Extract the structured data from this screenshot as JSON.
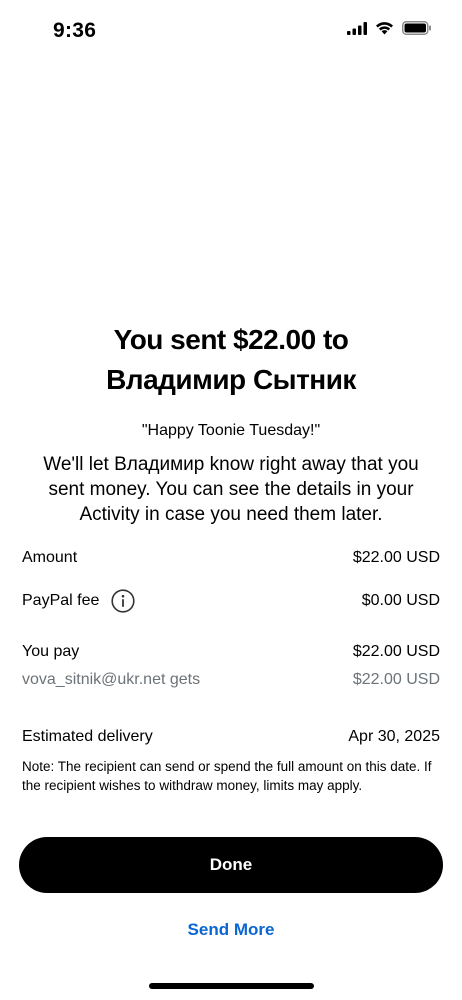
{
  "status_bar": {
    "time": "9:36",
    "icons": [
      "cellular-signal-icon",
      "wifi-icon",
      "battery-icon"
    ]
  },
  "confirmation": {
    "title_line1": "You sent $22.00 to",
    "title_line2": "Владимир Сытник",
    "note": "\"Happy Toonie Tuesday!\"",
    "message": "We'll let Владимир know right away that you sent money. You can see the details in your Activity in case you need them later."
  },
  "summary": {
    "amount_label": "Amount",
    "amount_value": "$22.00 USD",
    "fee_label": "PayPal fee",
    "fee_value": "$0.00 USD",
    "you_pay_label": "You pay",
    "you_pay_value": "$22.00 USD",
    "recipient_gets_label": "vova_sitnik@ukr.net gets",
    "recipient_gets_value": "$22.00 USD",
    "delivery_label": "Estimated delivery",
    "delivery_value": "Apr 30, 2025",
    "delivery_note": "Note: The recipient can send or spend the full amount on this date. If the recipient wishes to withdraw money, limits may apply."
  },
  "actions": {
    "done_label": "Done",
    "send_more_label": "Send More"
  },
  "colors": {
    "link": "#0a66d2",
    "muted_text": "#6c7378",
    "button_bg": "#000000"
  }
}
